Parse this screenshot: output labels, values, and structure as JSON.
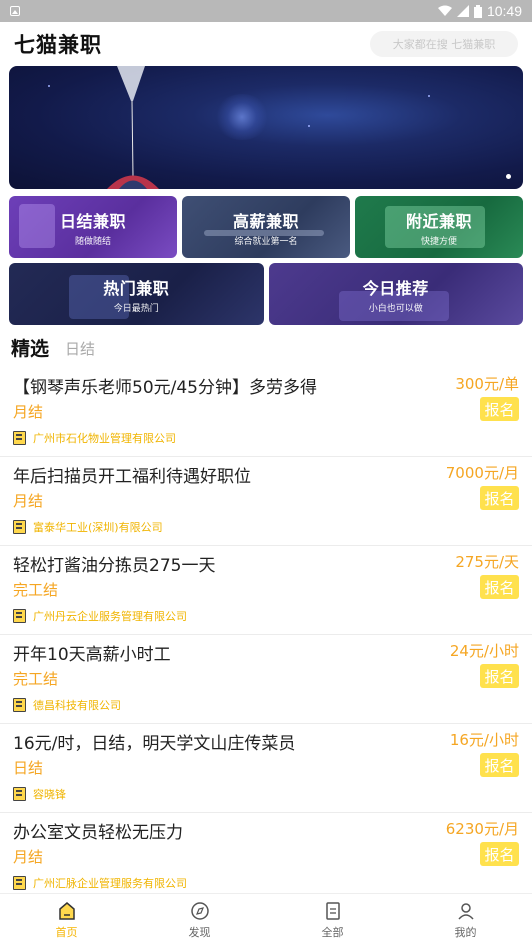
{
  "status_bar": {
    "time": "10:49"
  },
  "header": {
    "title": "七猫兼职",
    "search_placeholder": "大家都在搜 七猫兼职"
  },
  "categories": [
    {
      "title": "日结兼职",
      "subtitle": "随做随结"
    },
    {
      "title": "高薪兼职",
      "subtitle": "综合就业第一名"
    },
    {
      "title": "附近兼职",
      "subtitle": "快捷方便"
    },
    {
      "title": "热门兼职",
      "subtitle": "今日最热门"
    },
    {
      "title": "今日推荐",
      "subtitle": "小白也可以做"
    }
  ],
  "tabs": {
    "active": "精选",
    "inactive": "日结"
  },
  "apply_label": "报名",
  "jobs": [
    {
      "title": "【钢琴声乐老师50元/45分钟】多劳多得",
      "salary": "300元/单",
      "settlement": "月结",
      "company": "广州市石化物业管理有限公司"
    },
    {
      "title": "年后扫描员开工福利待遇好职位",
      "salary": "7000元/月",
      "settlement": "月结",
      "company": "富泰华工业(深圳)有限公司"
    },
    {
      "title": "轻松打酱油分拣员275一天",
      "salary": "275元/天",
      "settlement": "完工结",
      "company": "广州丹云企业服务管理有限公司"
    },
    {
      "title": "开年10天高薪小时工",
      "salary": "24元/小时",
      "settlement": "完工结",
      "company": "德昌科技有限公司"
    },
    {
      "title": "16元/时，日结，明天学文山庄传菜员",
      "salary": "16元/小时",
      "settlement": "日结",
      "company": "容晓锋"
    },
    {
      "title": "办公室文员轻松无压力",
      "salary": "6230元/月",
      "settlement": "月结",
      "company": "广州汇脉企业管理服务有限公司"
    }
  ],
  "bottom_nav": [
    {
      "label": "首页"
    },
    {
      "label": "发现"
    },
    {
      "label": "全部"
    },
    {
      "label": "我的"
    }
  ],
  "colors": {
    "accent": "#f5a623",
    "apply_bg": "#ffe14d",
    "nav_active": "#f5b400"
  }
}
